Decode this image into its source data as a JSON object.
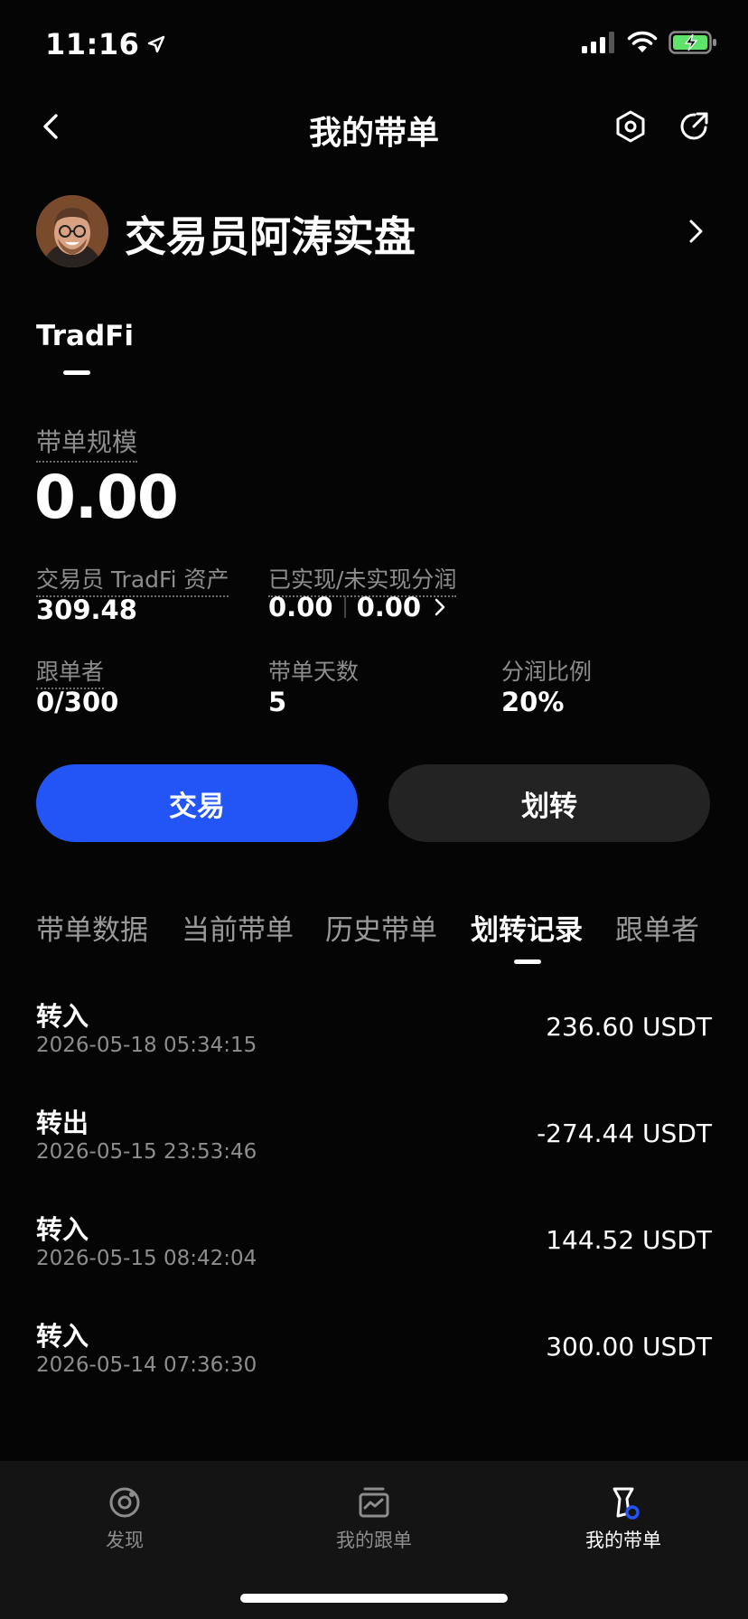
{
  "status_bar": {
    "time": "11:16"
  },
  "nav": {
    "title": "我的带单"
  },
  "trader": {
    "name": "交易员阿涛实盘"
  },
  "tradfi_tab": {
    "label": "TradFi"
  },
  "scale": {
    "label": "带单规模",
    "value": "0.00"
  },
  "stats": {
    "assets_label": "交易员 TradFi 资产",
    "assets_value": "309.48",
    "pnl_label": "已实现/未实现分润",
    "realized": "0.00",
    "unrealized": "0.00",
    "followers_label": "跟单者",
    "followers_value": "0/300",
    "days_label": "带单天数",
    "days_value": "5",
    "share_label": "分润比例",
    "share_value": "20%"
  },
  "buttons": {
    "trade": "交易",
    "transfer": "划转"
  },
  "tabs": [
    {
      "label": "带单数据",
      "active": false
    },
    {
      "label": "当前带单",
      "active": false
    },
    {
      "label": "历史带单",
      "active": false
    },
    {
      "label": "划转记录",
      "active": true
    },
    {
      "label": "跟单者",
      "active": false
    }
  ],
  "records": [
    {
      "type": "转入",
      "time": "2026-05-18 05:34:15",
      "amount": "236.60 USDT"
    },
    {
      "type": "转出",
      "time": "2026-05-15 23:53:46",
      "amount": "-274.44 USDT"
    },
    {
      "type": "转入",
      "time": "2026-05-15 08:42:04",
      "amount": "144.52 USDT"
    },
    {
      "type": "转入",
      "time": "2026-05-14 07:36:30",
      "amount": "300.00 USDT"
    }
  ],
  "bottom_nav": [
    {
      "label": "发现",
      "icon": "discover-icon",
      "active": false
    },
    {
      "label": "我的跟单",
      "icon": "copy-trade-icon",
      "active": false
    },
    {
      "label": "我的带单",
      "icon": "lead-trade-icon",
      "active": true
    }
  ],
  "colors": {
    "accent": "#2354f5",
    "background": "#050505",
    "muted": "#8d8d8d"
  }
}
